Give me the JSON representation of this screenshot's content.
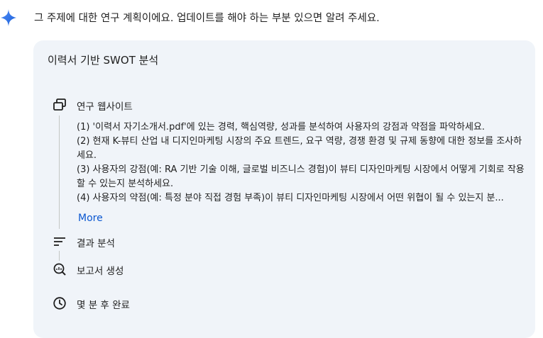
{
  "message": {
    "text": "그 주제에 대한 연구 계획이에요. 업데이트를 해야 하는 부분 있으면 알려 주세요."
  },
  "plan": {
    "title": "이력서 기반 SWOT 분석",
    "steps": [
      {
        "label": "연구 웹사이트",
        "icon": "web-research-icon"
      },
      {
        "label": "결과 분석",
        "icon": "analysis-lines-icon"
      },
      {
        "label": "보고서 생성",
        "icon": "report-search-icon"
      },
      {
        "label": "몇 분 후 완료",
        "icon": "clock-icon"
      }
    ],
    "detail_lines": [
      "(1) '이력서 자기소개서.pdf'에 있는 경력, 핵심역량, 성과를 분석하여 사용자의 강점과 약점을 파악하세요.",
      "(2) 현재 K-뷰티 산업 내 디지인마케팅 시장의 주요 트렌드, 요구 역량, 경쟁 환경 및 규제 동향에 대한 정보를 조사하세요.",
      "(3) 사용자의 강점(예: RA 기반 기술 이해, 글로벌 비즈니스 경험)이 뷰티 디자인마케팅 시장에서 어떻게 기회로 작용할 수 있는지 분석하세요.",
      "(4) 사용자의 약점(예: 특정 분야 직접 경험 부족)이 뷰티 디자인마케팅 시장에서 어떤 위협이 될 수 있는지 분..."
    ],
    "more_label": "More"
  },
  "colors": {
    "link": "#0b57d0",
    "card_bg": "#f0f4f9",
    "connector": "#c4c7c5"
  }
}
